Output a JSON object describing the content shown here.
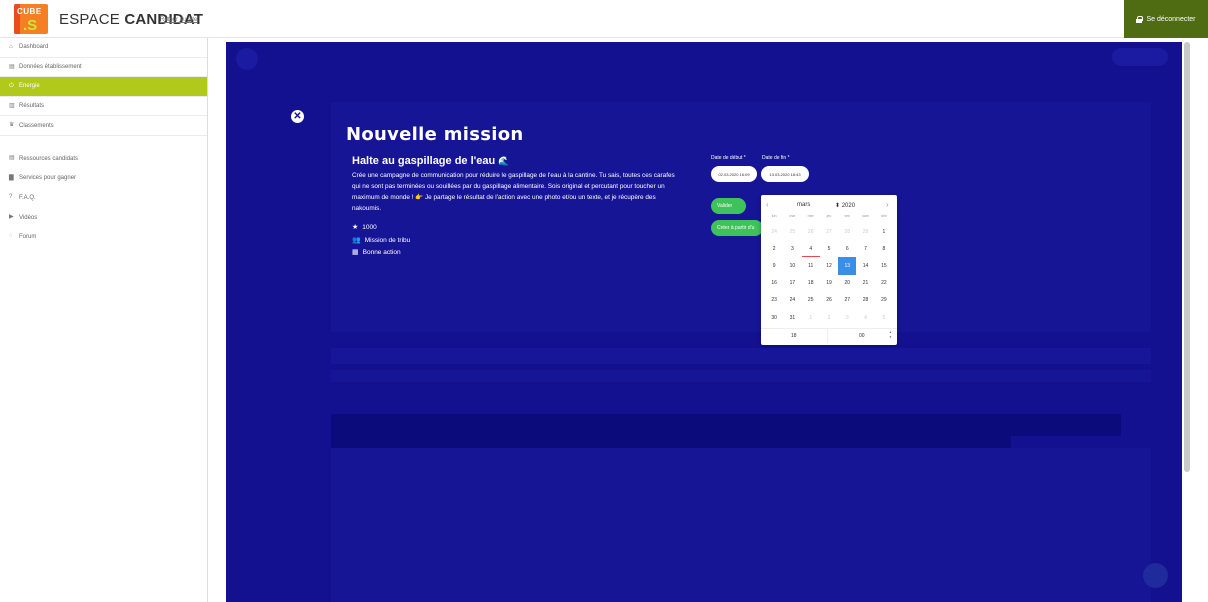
{
  "header": {
    "logo_text": "CUBE .S",
    "app_name_light": "ESPACE ",
    "app_name_bold": "CANDIDAT",
    "back_link": "Retour au site",
    "logout_label": "Se déconnecter"
  },
  "sidebar": {
    "items": [
      {
        "label": "Dashboard",
        "icon": "home-icon"
      },
      {
        "label": "Données établissement",
        "icon": "building-icon"
      },
      {
        "label": "Energie",
        "icon": "power-icon",
        "active": true
      },
      {
        "label": "Résultats",
        "icon": "bar-chart-icon"
      },
      {
        "label": "Classements",
        "icon": "trophy-icon"
      },
      {
        "label": "Ressources candidats",
        "icon": "document-icon"
      },
      {
        "label": "Services pour gagner",
        "icon": "file-icon"
      },
      {
        "label": "F.A.Q.",
        "icon": "question-icon"
      },
      {
        "label": "Vidéos",
        "icon": "video-icon"
      },
      {
        "label": "Forum",
        "icon": "chat-icon"
      }
    ]
  },
  "modal": {
    "title": "Nouvelle mission",
    "mission_name": "Halte au gaspillage de l'eau",
    "description_lines": [
      "Crée une campagne de communication pour réduire le gaspillage de l'eau à la cantine. Tu sais, toutes ces carafes",
      "qui ne sont pas terminées ou souillées par du gaspillage alimentaire. Sois original et percutant pour toucher un",
      "maximum de monde ! 👉 Je partage le résultat de l'action avec une photo et/ou un texte, et je récupère des",
      "nakoumis."
    ],
    "points": "1000",
    "category": "Mission de tribu",
    "type": "Bonne action",
    "start_label": "Date de début *",
    "end_label": "Date de fin *",
    "start_value": "02.03.2020 16:09",
    "end_value": "13.03.2020 18:43",
    "validate_label": "Valider",
    "create_label": "Créer à partir d'u"
  },
  "calendar": {
    "month": "mars",
    "year": "2020",
    "weekdays": [
      "lun",
      "mar",
      "mer",
      "jeu",
      "ven",
      "sam",
      "dim"
    ],
    "days": [
      {
        "d": "24",
        "m": true
      },
      {
        "d": "25",
        "m": true
      },
      {
        "d": "26",
        "m": true
      },
      {
        "d": "27",
        "m": true
      },
      {
        "d": "28",
        "m": true
      },
      {
        "d": "29",
        "m": true
      },
      {
        "d": "1"
      },
      {
        "d": "2"
      },
      {
        "d": "3"
      },
      {
        "d": "4"
      },
      {
        "d": "5"
      },
      {
        "d": "6"
      },
      {
        "d": "7"
      },
      {
        "d": "8"
      },
      {
        "d": "9"
      },
      {
        "d": "10"
      },
      {
        "d": "11"
      },
      {
        "d": "12"
      },
      {
        "d": "13",
        "sel": true
      },
      {
        "d": "14"
      },
      {
        "d": "15"
      },
      {
        "d": "16"
      },
      {
        "d": "17"
      },
      {
        "d": "18"
      },
      {
        "d": "19"
      },
      {
        "d": "20"
      },
      {
        "d": "21"
      },
      {
        "d": "22"
      },
      {
        "d": "23"
      },
      {
        "d": "24"
      },
      {
        "d": "25"
      },
      {
        "d": "26"
      },
      {
        "d": "27"
      },
      {
        "d": "28"
      },
      {
        "d": "29"
      },
      {
        "d": "30"
      },
      {
        "d": "31"
      },
      {
        "d": "1",
        "m": true
      },
      {
        "d": "2",
        "m": true
      },
      {
        "d": "3",
        "m": true
      },
      {
        "d": "4",
        "m": true
      },
      {
        "d": "5",
        "m": true
      }
    ],
    "hour": "18",
    "minute": "00"
  }
}
